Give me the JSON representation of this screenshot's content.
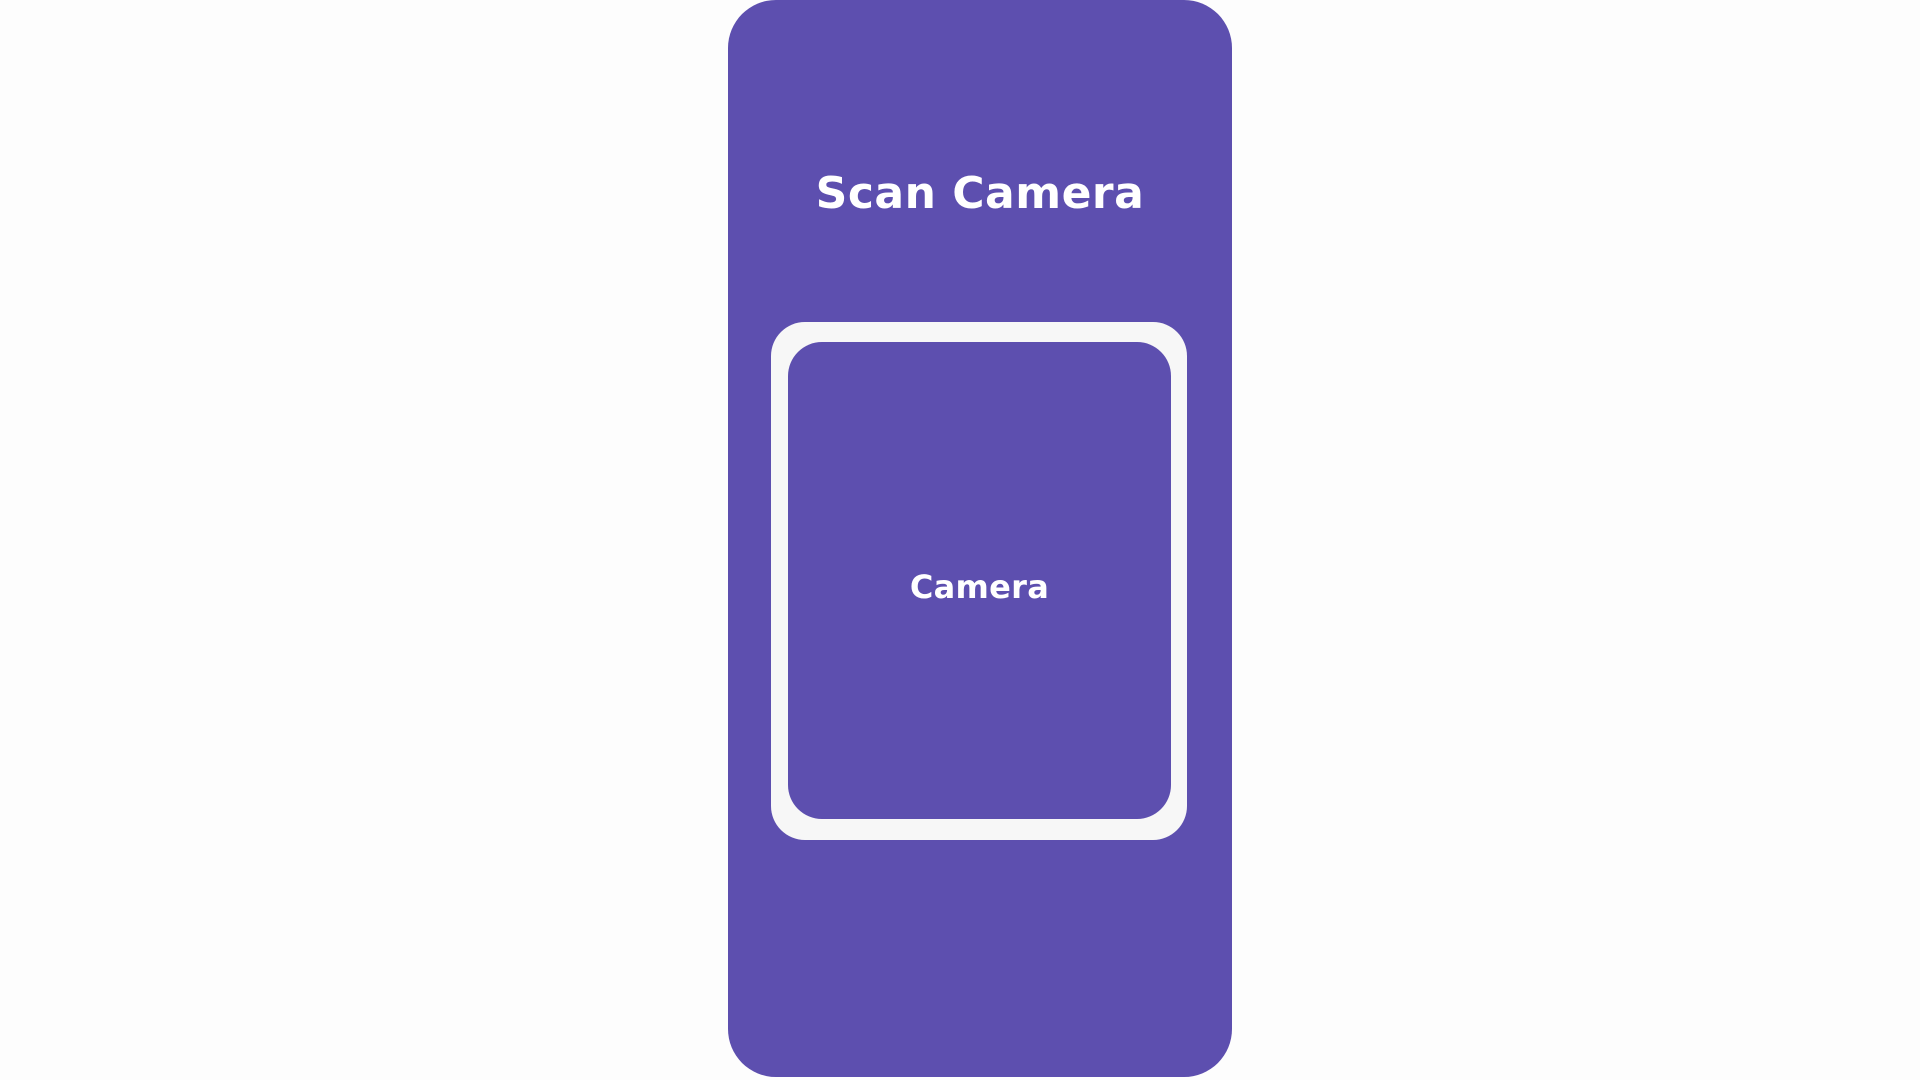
{
  "screen": {
    "title": "Scan Camera",
    "camera_placeholder_label": "Camera"
  },
  "colors": {
    "page_background": "#fdfdfd",
    "phone_background": "#5d4faf",
    "frame_border": "#f7f7f7",
    "text": "#ffffff"
  }
}
